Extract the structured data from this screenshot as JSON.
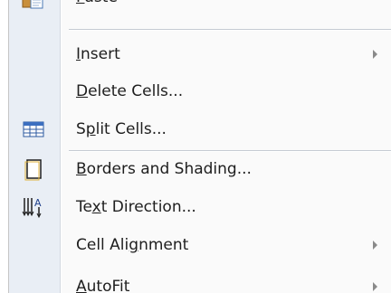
{
  "menu": {
    "items": [
      {
        "pre": "",
        "ul": "P",
        "post": "aste",
        "arrow": false,
        "icon": "paste-icon"
      },
      {
        "pre": "",
        "ul": "I",
        "post": "nsert",
        "arrow": true,
        "icon": ""
      },
      {
        "pre": "",
        "ul": "D",
        "post": "elete Cells...",
        "arrow": false,
        "icon": ""
      },
      {
        "pre": "S",
        "ul": "p",
        "post": "lit Cells...",
        "arrow": false,
        "icon": "split-cells-icon"
      },
      {
        "pre": "",
        "ul": "B",
        "post": "orders and Shading...",
        "arrow": false,
        "icon": "borders-shading-icon"
      },
      {
        "pre": "Te",
        "ul": "x",
        "post": "t Direction...",
        "arrow": false,
        "icon": "text-direction-icon"
      },
      {
        "pre": "Cell Ali",
        "ul": "g",
        "post": "nment",
        "arrow": true,
        "icon": ""
      },
      {
        "pre": "",
        "ul": "A",
        "post": "utoFit",
        "arrow": true,
        "icon": ""
      }
    ]
  }
}
